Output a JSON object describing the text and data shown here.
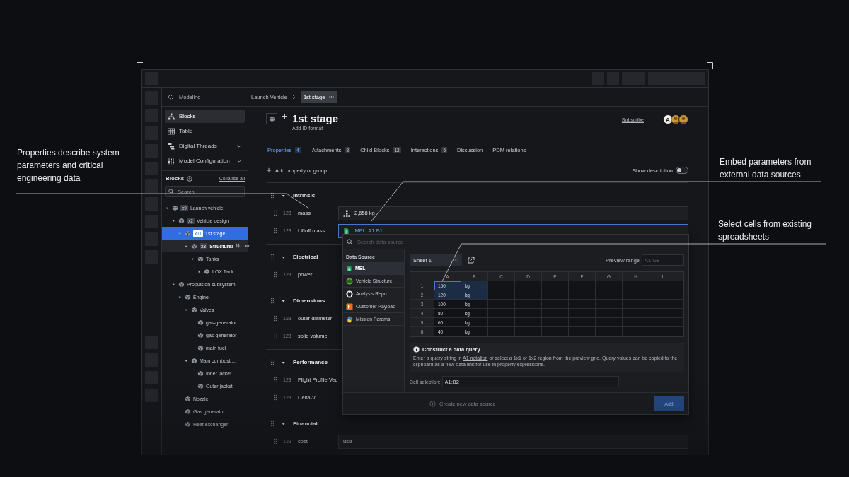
{
  "callouts": [
    {
      "text": "Properties describe system parameters and critical engineering data"
    },
    {
      "text": "Embed parameters from external data sources"
    },
    {
      "text": "Select cells from existing spreadsheets"
    }
  ],
  "sidebar": {
    "title": "Modeling",
    "nav": [
      {
        "label": "Blocks",
        "kind": "blocks",
        "selected": true,
        "expandable": false
      },
      {
        "label": "Table",
        "kind": "table",
        "selected": false,
        "expandable": false
      },
      {
        "label": "Digital Threads",
        "kind": "threads",
        "selected": false,
        "expandable": true
      },
      {
        "label": "Model Configuration",
        "kind": "config",
        "selected": false,
        "expandable": true
      }
    ],
    "tree_title": "Blocks",
    "collapse_label": "Collapse all",
    "search": {
      "placeholder": "Search"
    },
    "tree": [
      {
        "label": "Launch vehicle",
        "badge": "x9",
        "expanded": true,
        "selected": false,
        "children": [
          {
            "label": "Vehicle design",
            "badge": "x2",
            "expanded": true,
            "selected": false,
            "children": [
              {
                "label": "1st stage",
                "badge": "x11",
                "expanded": true,
                "selected": true,
                "children": [
                  {
                    "label": "Structural",
                    "badge": "x3",
                    "expanded": true,
                    "selected": false,
                    "hovered": true,
                    "children": [
                      {
                        "label": "Tanks",
                        "expanded": true,
                        "selected": false,
                        "children": [
                          {
                            "label": "LOX Tank",
                            "expanded": false,
                            "selected": false
                          }
                        ]
                      }
                    ]
                  }
                ]
              }
            ]
          },
          {
            "label": "Propulsion subsystem",
            "expanded": true,
            "selected": false,
            "children": [
              {
                "label": "Engine",
                "expanded": true,
                "selected": false,
                "children": [
                  {
                    "label": "Valves",
                    "expanded": true,
                    "selected": false,
                    "children": [
                      {
                        "label": "gas-generator",
                        "selected": false
                      },
                      {
                        "label": "gas-generator",
                        "selected": false
                      },
                      {
                        "label": "main fuel",
                        "selected": false
                      }
                    ]
                  },
                  {
                    "label": "Main combusti...",
                    "expanded": true,
                    "selected": false,
                    "children": [
                      {
                        "label": "Inner jacket",
                        "selected": false
                      },
                      {
                        "label": "Outer jacket",
                        "selected": false
                      }
                    ]
                  }
                ]
              },
              {
                "label": "Nozzle",
                "selected": false
              },
              {
                "label": "Gas generator",
                "selected": false
              },
              {
                "label": "Heat exchanger",
                "selected": false
              }
            ]
          }
        ]
      }
    ]
  },
  "breadcrumb": [
    {
      "label": "Launch Vehicle",
      "current": false
    },
    {
      "label": "1st stage",
      "current": true
    }
  ],
  "header": {
    "title": "1st stage",
    "id_link": "Add ID format",
    "subscribe": "Subscribe",
    "avatars": [
      {
        "kind": "initial",
        "initial": "A"
      },
      {
        "kind": "photo"
      },
      {
        "kind": "photo"
      }
    ]
  },
  "tabs": [
    {
      "label": "Properties",
      "count": "4",
      "selected": true
    },
    {
      "label": "Attachments",
      "count": "8",
      "selected": false
    },
    {
      "label": "Child Blocks",
      "count": "12",
      "selected": false
    },
    {
      "label": "Interactions",
      "count": "5",
      "selected": false
    },
    {
      "label": "Discussion",
      "selected": false
    },
    {
      "label": "PDM relations",
      "selected": false
    }
  ],
  "add_property": "Add property or group",
  "show_description": {
    "label": "Show description",
    "on": false
  },
  "groups": [
    {
      "name": "Intrinsic",
      "expanded": true,
      "properties": [
        {
          "type": "123",
          "name": "mass",
          "value": "2,658 kg",
          "kind": "rollup",
          "focused": false
        },
        {
          "type": "123",
          "name": "Liftoff mass",
          "value": "'MEL':A1:B1",
          "kind": "sheet",
          "focused": true
        }
      ]
    },
    {
      "name": "Electrical",
      "expanded": true,
      "properties": [
        {
          "type": "123",
          "name": "power"
        }
      ]
    },
    {
      "name": "Dimensions",
      "expanded": true,
      "properties": [
        {
          "type": "123",
          "name": "outer diameter"
        },
        {
          "type": "123",
          "name": "solid volume"
        }
      ]
    },
    {
      "name": "Performance",
      "expanded": true,
      "properties": [
        {
          "type": "123",
          "name": "Flight Profile Vec"
        },
        {
          "type": "123",
          "name": "Delta-V"
        }
      ]
    },
    {
      "name": "Financial",
      "expanded": true,
      "properties": [
        {
          "type": "123",
          "name": "cost",
          "value": "usd",
          "kind": "plain",
          "focused": false
        }
      ]
    }
  ],
  "popup": {
    "search_placeholder": "Search data source",
    "sources_title": "Data Source",
    "sources": [
      {
        "label": "MEL",
        "kind": "sheet",
        "selected": true
      },
      {
        "label": "Vehicle Structure",
        "kind": "cube",
        "selected": false
      },
      {
        "label": "Analysis Repo",
        "kind": "git",
        "selected": false
      },
      {
        "label": "Customer Payload",
        "kind": "letter",
        "selected": false
      },
      {
        "label": "Mission Params",
        "kind": "python",
        "selected": false
      }
    ],
    "sheet": "Sheet 1",
    "preview_label": "Preview range",
    "preview_placeholder": "A1:G8",
    "columns": [
      "A",
      "B",
      "C",
      "D",
      "E",
      "F",
      "G",
      "H",
      "I"
    ],
    "rows": [
      {
        "label": "1",
        "cells": [
          {
            "value": "150",
            "selected": true,
            "focused": true
          },
          {
            "value": "kg",
            "selected": true,
            "focused": false
          }
        ]
      },
      {
        "label": "2",
        "cells": [
          {
            "value": "120",
            "selected": true,
            "focused": false
          },
          {
            "value": "kg",
            "selected": true,
            "focused": false
          }
        ]
      },
      {
        "label": "3",
        "cells": [
          {
            "value": "100",
            "selected": false,
            "focused": false
          },
          {
            "value": "kg",
            "selected": false,
            "focused": false
          }
        ]
      },
      {
        "label": "4",
        "cells": [
          {
            "value": "80",
            "selected": false,
            "focused": false
          },
          {
            "value": "kg",
            "selected": false,
            "focused": false
          }
        ]
      },
      {
        "label": "5",
        "cells": [
          {
            "value": "60",
            "selected": false,
            "focused": false
          },
          {
            "value": "kg",
            "selected": false,
            "focused": false
          }
        ]
      },
      {
        "label": "6",
        "cells": [
          {
            "value": "40",
            "selected": false,
            "focused": false
          },
          {
            "value": "kg",
            "selected": false,
            "focused": false
          }
        ]
      }
    ],
    "info": {
      "title": "Construct a data query",
      "text_before": "Enter a query string in",
      "link": "A1 notation",
      "text_after": "or select a 1x1 or 1x2 region from the preview grid. Query values can be copied to the clipboard as a new data link for use in property expressions."
    },
    "cell_selection": {
      "label": "Cell selection:",
      "value": "A1:B2"
    },
    "create_link": "Create new data source",
    "add_button": "Add"
  }
}
